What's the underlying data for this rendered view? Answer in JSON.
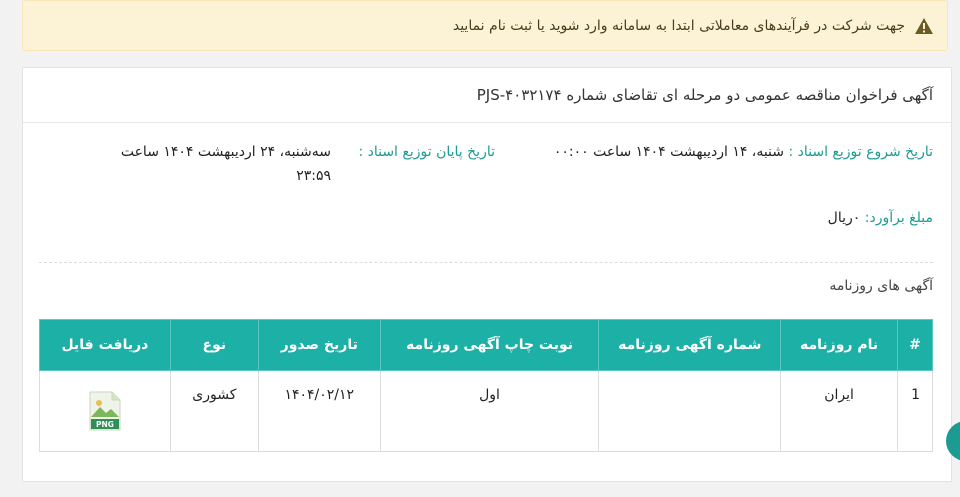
{
  "alert": {
    "text": "جهت شرکت در فرآیندهای معاملاتی ابتدا به سامانه وارد شوید یا ثبت نام نمایید",
    "icon": "warning-icon"
  },
  "card": {
    "title": "آگهی فراخوان مناقصه عمومی دو مرحله ای تقاضای شماره PJS-۴۰۳۲۱۷۴",
    "start_label": "تاریخ شروع توزیع اسناد :",
    "start_value": "شنبه، ۱۴ اردیبهشت ۱۴۰۴ ساعت ۰۰:۰۰",
    "end_label": "تاریخ پایان توزیع اسناد :",
    "end_value": "سه‌شنبه، ۲۴ اردیبهشت ۱۴۰۴ ساعت ۲۳:۵۹",
    "estimate_label": "مبلغ برآورد:",
    "estimate_value": "۰ریال",
    "section_title": "آگهی های روزنامه"
  },
  "table": {
    "headers": [
      "#",
      "نام روزنامه",
      "شماره آگهی روزنامه",
      "نوبت چاپ آگهی روزنامه",
      "تاریخ صدور",
      "نوع",
      "دریافت فایل"
    ],
    "rows": [
      {
        "index": "1",
        "name": "ایران",
        "number": "",
        "turn": "اول",
        "date": "۱۴۰۴/۰۲/۱۲",
        "type": "کشوری",
        "file": "PNG"
      }
    ]
  },
  "colors": {
    "accent": "#1cb0a6",
    "alert_bg": "#fcf3d6"
  }
}
